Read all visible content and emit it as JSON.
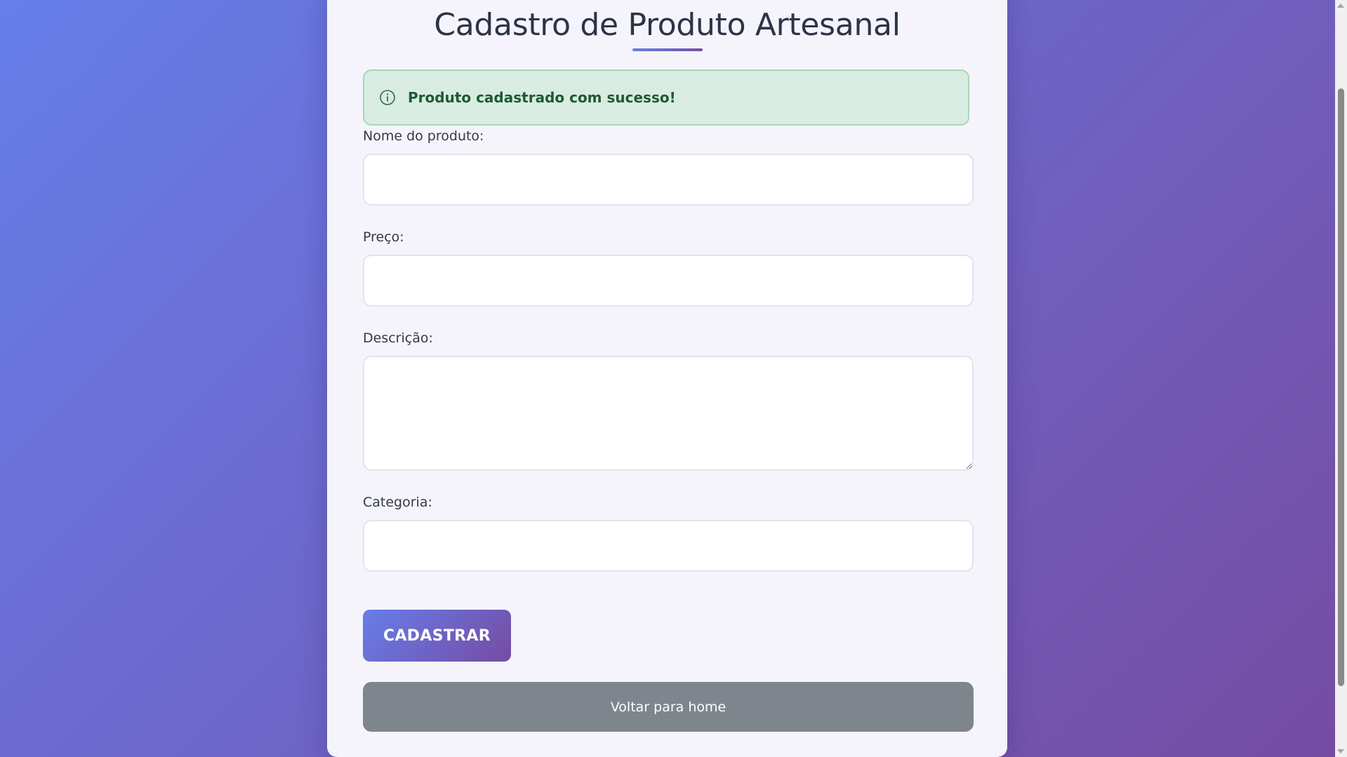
{
  "page": {
    "title": "Cadastro de Produto Artesanal"
  },
  "alert": {
    "icon": "info-circle-icon",
    "message": "Produto cadastrado com sucesso!",
    "color": "#1d5a33",
    "background": "#d9ece1"
  },
  "form": {
    "fields": [
      {
        "label": "Nome do produto:",
        "value": "",
        "placeholder": ""
      },
      {
        "label": "Preço:",
        "value": "",
        "placeholder": ""
      },
      {
        "label": "Descrição:",
        "value": "",
        "placeholder": ""
      },
      {
        "label": "Categoria:",
        "value": "",
        "placeholder": ""
      }
    ],
    "submit_label": "CADASTRAR",
    "back_label": "Voltar para home"
  },
  "theme": {
    "gradient_start": "#667eea",
    "gradient_end": "#764ba2",
    "secondary_button": "#7f858d"
  }
}
